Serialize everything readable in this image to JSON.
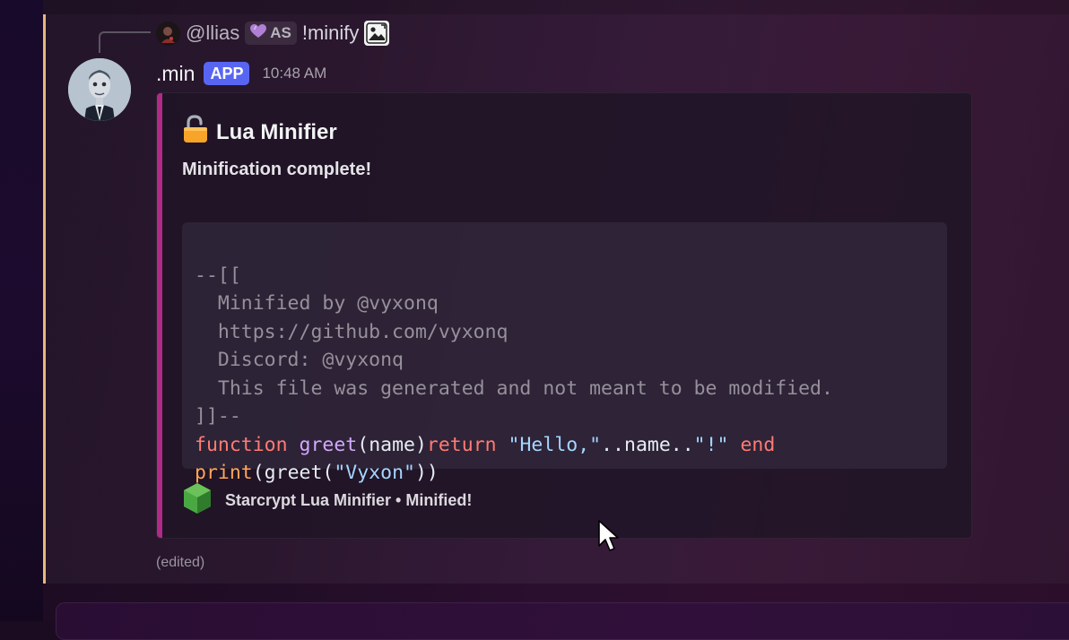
{
  "reply": {
    "username": "@llias",
    "tag_icon": "purple-heart-icon",
    "tag_label": "AS",
    "command": "!minify",
    "attachment_icon": "image-icon"
  },
  "message": {
    "username": ".min",
    "badge": "APP",
    "timestamp": "10:48 AM",
    "edited_label": "(edited)"
  },
  "embed": {
    "accent_color": "#b12a88",
    "title_icon": "unlocked-padlock-icon",
    "title": "Lua Minifier",
    "description": "Minification complete!",
    "code": {
      "language": "lua",
      "comment_open": "--[[",
      "comment_lines": [
        "  Minified by @vyxonq",
        "  https://github.com/vyxonq",
        "  Discord: @vyxonq",
        "  This file was generated and not meant to be modified."
      ],
      "comment_close": "]]--",
      "line1": {
        "kw_function": "function",
        "fn_name": "greet",
        "params": "(name)",
        "kw_return": "return",
        "str1": "\"Hello,\"",
        "concat": "..name..",
        "str2": "\"!\"",
        "kw_end": "end"
      },
      "line2": {
        "builtin": "print",
        "open": "(greet(",
        "str": "\"Vyxon\"",
        "close": "))"
      }
    },
    "footer_icon": "green-gem-icon",
    "footer_text": "Starcrypt Lua Minifier • Minified!"
  },
  "colors": {
    "highlight_bar": "#e8b879",
    "app_badge": "#5865f2"
  }
}
